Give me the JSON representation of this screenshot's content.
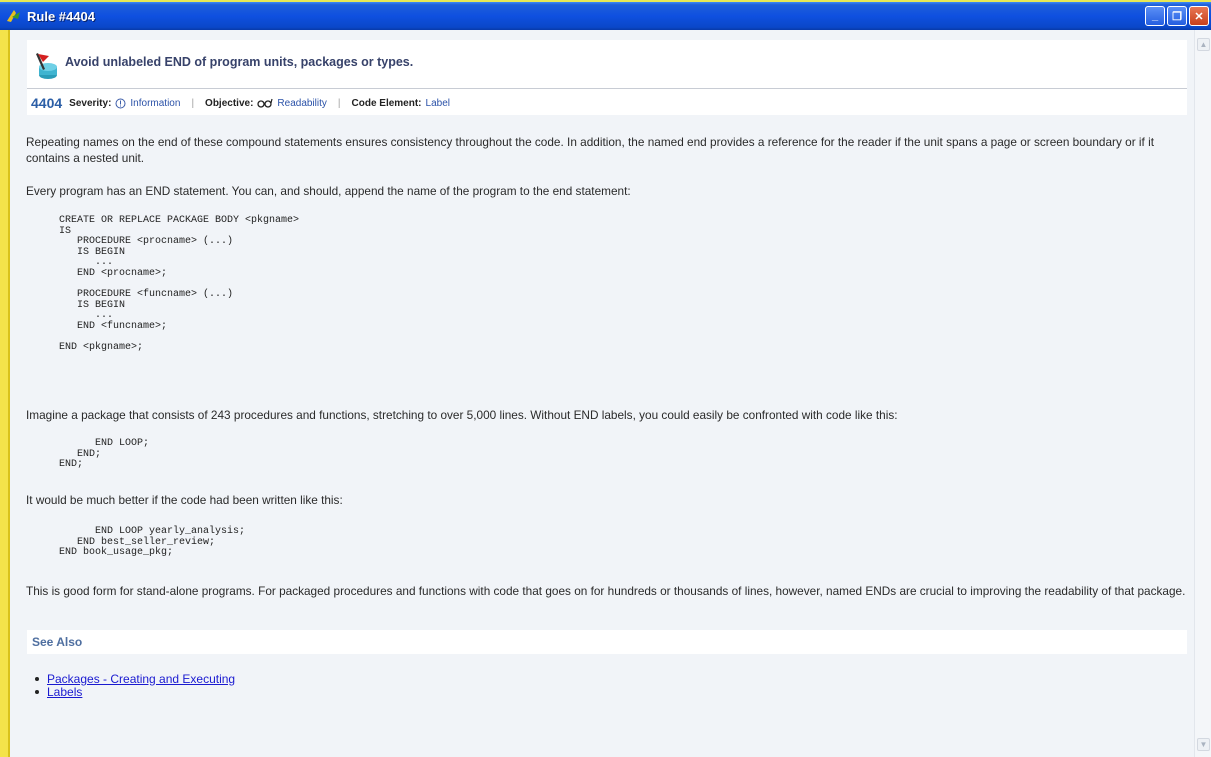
{
  "window": {
    "title": "Rule #4404",
    "buttons": [
      "minimize",
      "maximize",
      "close"
    ]
  },
  "rule": {
    "title": "Avoid unlabeled END of program units, packages or types.",
    "number": "4404",
    "severity_label": "Severity:",
    "severity_value": "Information",
    "objective_label": "Objective:",
    "objective_value": "Readability",
    "code_element_label": "Code Element:",
    "code_element_value": "Label"
  },
  "body": {
    "para1": "Repeating names on the end of these compound statements ensures consistency throughout the code. In addition, the named end provides a reference for the reader if the unit spans a page or screen boundary or if it contains a nested unit.",
    "para2": "Every program has an END statement. You can, and should, append the name of the program to the end statement:",
    "code1": "CREATE OR REPLACE PACKAGE BODY <pkgname>\nIS\n   PROCEDURE <procname> (...)\n   IS BEGIN\n      ...\n   END <procname>;\n\n   PROCEDURE <funcname> (...)\n   IS BEGIN\n      ...\n   END <funcname>;\n\nEND <pkgname>;",
    "para3": "Imagine a package that consists of 243 procedures and functions, stretching to over 5,000 lines. Without END labels, you could easily be confronted with code like this:",
    "code2": "      END LOOP;\n   END;\nEND;",
    "para4": "It would be much better if the code had been written like this:",
    "code3": "      END LOOP yearly_analysis;\n   END best_seller_review;\nEND book_usage_pkg;",
    "para5": "This is good form for stand-alone programs. For packaged procedures and functions with code that goes on for hundreds or thousands of lines, however, named ENDs are crucial to improving the readability of that package."
  },
  "see_also": {
    "heading": "See Also",
    "links": [
      "Packages - Creating and Executing",
      "Labels"
    ]
  },
  "colors": {
    "title_bar": "#0f50e0",
    "left_bar": "#f4e34a",
    "background": "#f1f4f8",
    "link": "#1a1ad0"
  }
}
